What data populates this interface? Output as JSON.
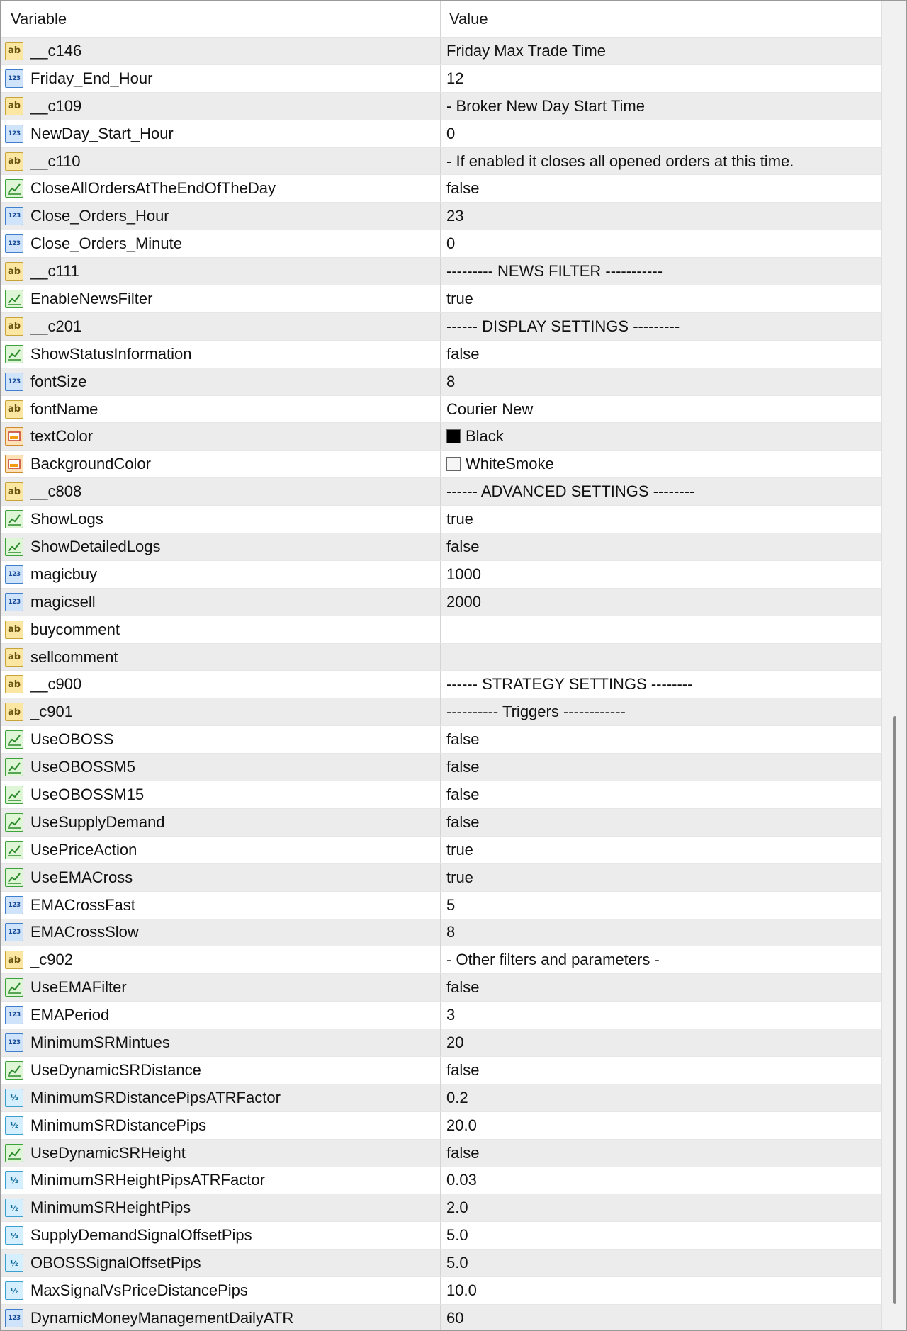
{
  "header": {
    "variable": "Variable",
    "value": "Value"
  },
  "rows": [
    {
      "type": "ab",
      "name": "__c146",
      "value": "Friday Max Trade Time"
    },
    {
      "type": "num",
      "name": "Friday_End_Hour",
      "value": "12"
    },
    {
      "type": "ab",
      "name": "__c109",
      "value": "- Broker New Day Start Time"
    },
    {
      "type": "num",
      "name": "NewDay_Start_Hour",
      "value": "0"
    },
    {
      "type": "ab",
      "name": "__c110",
      "value": "- If enabled it closes all opened orders at this time."
    },
    {
      "type": "bool",
      "name": "CloseAllOrdersAtTheEndOfTheDay",
      "value": "false"
    },
    {
      "type": "num",
      "name": "Close_Orders_Hour",
      "value": "23"
    },
    {
      "type": "num",
      "name": "Close_Orders_Minute",
      "value": "0"
    },
    {
      "type": "ab",
      "name": "__c111",
      "value": "--------- NEWS FILTER -----------"
    },
    {
      "type": "bool",
      "name": "EnableNewsFilter",
      "value": "true"
    },
    {
      "type": "ab",
      "name": "__c201",
      "value": "------ DISPLAY SETTINGS ---------"
    },
    {
      "type": "bool",
      "name": "ShowStatusInformation",
      "value": "false"
    },
    {
      "type": "num",
      "name": "fontSize",
      "value": "8"
    },
    {
      "type": "ab",
      "name": "fontName",
      "value": "Courier New"
    },
    {
      "type": "color",
      "name": "textColor",
      "value": "Black",
      "swatch": "#000000"
    },
    {
      "type": "color",
      "name": "BackgroundColor",
      "value": "WhiteSmoke",
      "swatch": "#f5f5f5"
    },
    {
      "type": "ab",
      "name": "__c808",
      "value": "------ ADVANCED SETTINGS --------"
    },
    {
      "type": "bool",
      "name": "ShowLogs",
      "value": "true"
    },
    {
      "type": "bool",
      "name": "ShowDetailedLogs",
      "value": "false"
    },
    {
      "type": "num",
      "name": "magicbuy",
      "value": "1000"
    },
    {
      "type": "num",
      "name": "magicsell",
      "value": "2000"
    },
    {
      "type": "ab",
      "name": "buycomment",
      "value": ""
    },
    {
      "type": "ab",
      "name": "sellcomment",
      "value": ""
    },
    {
      "type": "ab",
      "name": "__c900",
      "value": "------ STRATEGY SETTINGS --------"
    },
    {
      "type": "ab",
      "name": "_c901",
      "value": "---------- Triggers ------------"
    },
    {
      "type": "bool",
      "name": "UseOBOSS",
      "value": "false"
    },
    {
      "type": "bool",
      "name": "UseOBOSSM5",
      "value": "false"
    },
    {
      "type": "bool",
      "name": "UseOBOSSM15",
      "value": "false"
    },
    {
      "type": "bool",
      "name": "UseSupplyDemand",
      "value": "false"
    },
    {
      "type": "bool",
      "name": "UsePriceAction",
      "value": "true"
    },
    {
      "type": "bool",
      "name": "UseEMACross",
      "value": "true"
    },
    {
      "type": "num",
      "name": "EMACrossFast",
      "value": "5"
    },
    {
      "type": "num",
      "name": "EMACrossSlow",
      "value": "8"
    },
    {
      "type": "ab",
      "name": "_c902",
      "value": "- Other filters and parameters -"
    },
    {
      "type": "bool",
      "name": "UseEMAFilter",
      "value": "false"
    },
    {
      "type": "num",
      "name": "EMAPeriod",
      "value": "3"
    },
    {
      "type": "num",
      "name": "MinimumSRMintues",
      "value": "20"
    },
    {
      "type": "bool",
      "name": "UseDynamicSRDistance",
      "value": "false"
    },
    {
      "type": "frac",
      "name": "MinimumSRDistancePipsATRFactor",
      "value": "0.2"
    },
    {
      "type": "frac",
      "name": "MinimumSRDistancePips",
      "value": "20.0"
    },
    {
      "type": "bool",
      "name": "UseDynamicSRHeight",
      "value": "false"
    },
    {
      "type": "frac",
      "name": "MinimumSRHeightPipsATRFactor",
      "value": "0.03"
    },
    {
      "type": "frac",
      "name": "MinimumSRHeightPips",
      "value": "2.0"
    },
    {
      "type": "frac",
      "name": "SupplyDemandSignalOffsetPips",
      "value": "5.0"
    },
    {
      "type": "frac",
      "name": "OBOSSSignalOffsetPips",
      "value": "5.0"
    },
    {
      "type": "frac",
      "name": "MaxSignalVsPriceDistancePips",
      "value": "10.0"
    },
    {
      "type": "num",
      "name": "DynamicMoneyManagementDailyATR",
      "value": "60"
    }
  ]
}
